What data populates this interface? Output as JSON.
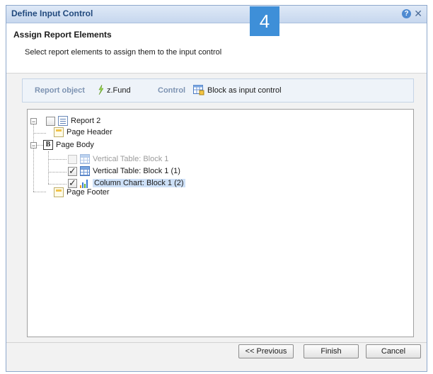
{
  "window": {
    "title": "Define Input Control",
    "help_symbol": "?",
    "close_symbol": "✕"
  },
  "step_badge": "4",
  "header": {
    "title": "Assign Report Elements",
    "description": "Select report elements to assign them to the input control"
  },
  "info_bar": {
    "report_object_label": "Report object",
    "report_object_value": "z.Fund",
    "control_label": "Control",
    "control_value": "Block as input control"
  },
  "tree": {
    "root_label": "Report 2",
    "page_header": "Page Header",
    "page_body": "Page Body",
    "body_icon_letter": "B",
    "items": [
      {
        "label": "Vertical Table: Block 1",
        "checked": false,
        "disabled": true,
        "icon": "vertical-table-icon"
      },
      {
        "label": "Vertical Table: Block 1 (1)",
        "checked": true,
        "disabled": false,
        "icon": "vertical-table-icon"
      },
      {
        "label": "Column Chart: Block 1 (2)",
        "checked": true,
        "disabled": false,
        "selected": true,
        "icon": "column-chart-icon"
      }
    ],
    "page_footer": "Page Footer",
    "collapse_symbol": "−"
  },
  "buttons": {
    "previous": "<< Previous",
    "finish": "Finish",
    "cancel": "Cancel"
  },
  "colors": {
    "accent": "#3e8fd8",
    "title_text": "#21497d",
    "selection": "#cde0f7"
  }
}
